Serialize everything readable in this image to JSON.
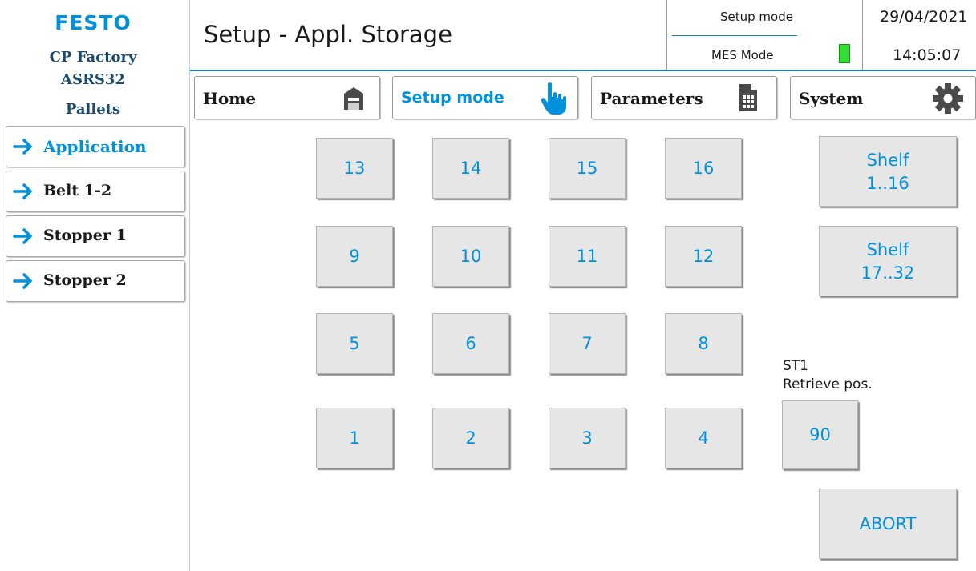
{
  "brand": {
    "logo": "FESTO",
    "line1": "CP Factory",
    "line2": "ASRS32",
    "line3": "Pallets"
  },
  "sidebar": {
    "items": [
      {
        "label": "Application",
        "active": true
      },
      {
        "label": "Belt 1-2",
        "active": false
      },
      {
        "label": "Stopper 1",
        "active": false
      },
      {
        "label": "Stopper 2",
        "active": false
      }
    ]
  },
  "header": {
    "title": "Setup - Appl. Storage",
    "mode": "Setup mode",
    "mes_mode": "MES Mode",
    "mes_indicator_color": "#33dd33",
    "date": "29/04/2021",
    "time": "14:05:07"
  },
  "nav": {
    "tabs": [
      {
        "label": "Home",
        "icon": "home-icon"
      },
      {
        "label": "Setup mode",
        "icon": "hand-pointer-icon",
        "active": true
      },
      {
        "label": "Parameters",
        "icon": "document-icon"
      },
      {
        "label": "System",
        "icon": "gear-icon"
      }
    ]
  },
  "grid": {
    "rows": [
      [
        "13",
        "14",
        "15",
        "16"
      ],
      [
        "9",
        "10",
        "11",
        "12"
      ],
      [
        "5",
        "6",
        "7",
        "8"
      ],
      [
        "1",
        "2",
        "3",
        "4"
      ]
    ]
  },
  "shelves": [
    {
      "line1": "Shelf",
      "line2": "1..16"
    },
    {
      "line1": "Shelf",
      "line2": "17..32"
    }
  ],
  "retrieve": {
    "label_line1": "ST1",
    "label_line2": "Retrieve pos.",
    "value": "90"
  },
  "abort_label": "ABORT",
  "colors": {
    "accent": "#0091dc",
    "button_face": "#e6e6e6",
    "header_line": "#1a7fc0"
  }
}
